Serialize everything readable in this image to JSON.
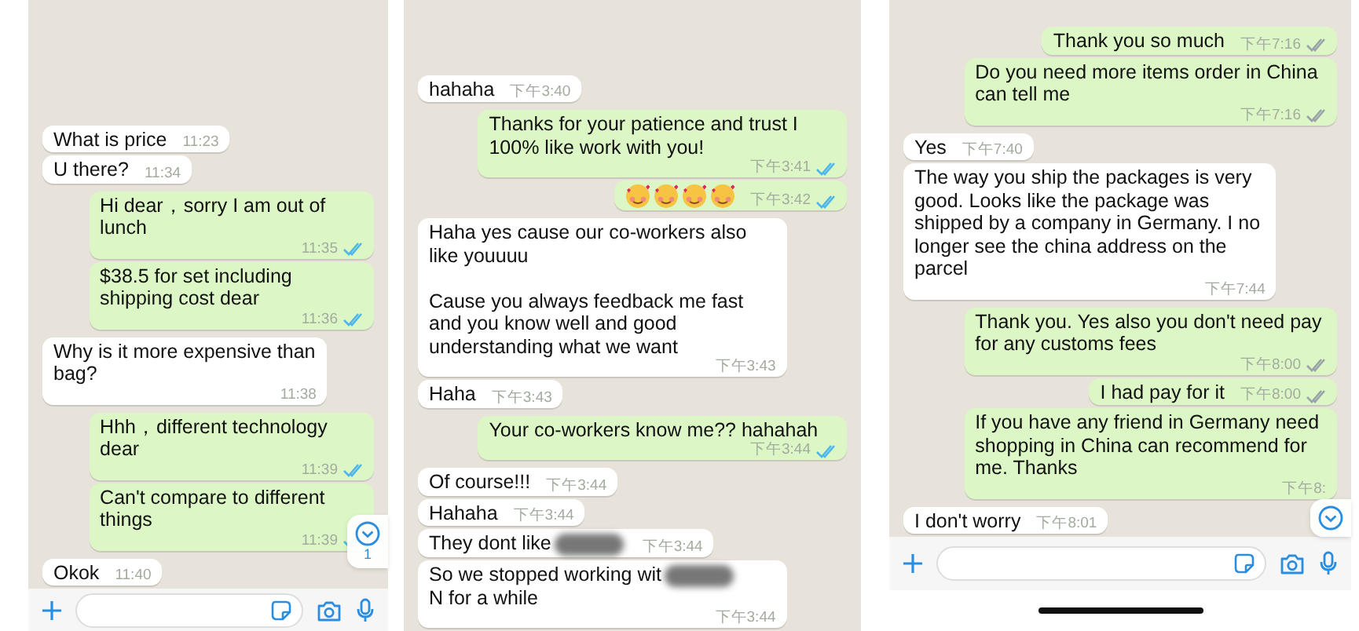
{
  "panels": [
    {
      "messages": [
        {
          "outgoing": false,
          "text": "What is price",
          "time": "11:23"
        },
        {
          "outgoing": false,
          "text": "U there?",
          "time": "11:34"
        },
        {
          "outgoing": true,
          "text": "Hi dear，sorry I am out of lunch",
          "time": "11:35",
          "read": true
        },
        {
          "outgoing": true,
          "text": "$38.5 for set including shipping cost dear",
          "time": "11:36",
          "read": true
        },
        {
          "outgoing": false,
          "text": "Why is it more expensive than bag?",
          "time": "11:38"
        },
        {
          "outgoing": true,
          "text": "Hhh，different technology dear",
          "time": "11:39",
          "read": true
        },
        {
          "outgoing": true,
          "text": "Can't compare to different things",
          "time": "11:39",
          "read": true
        },
        {
          "outgoing": false,
          "text": "Okok",
          "time": "11:40"
        }
      ],
      "scroll_down": true,
      "unread_badge": "1",
      "composer": true
    },
    {
      "messages": [
        {
          "outgoing": false,
          "text": "hahaha",
          "time": "下午3:40"
        },
        {
          "outgoing": true,
          "text": "Thanks for your patience and trust I 100% like work with you!",
          "time": "下午3:41",
          "read": true
        },
        {
          "outgoing": true,
          "kind": "emoji",
          "emojis": [
            {
              "kind": "heart-face"
            },
            {
              "kind": "heart-face"
            },
            {
              "kind": "heart-face"
            },
            {
              "kind": "heart-face"
            }
          ],
          "time": "下午3:42",
          "read": true
        },
        {
          "outgoing": false,
          "text": "Haha yes cause our co-workers also like youuuu\n\nCause you always feedback me fast and you know well and good understanding what we want",
          "time": "下午3:43"
        },
        {
          "outgoing": false,
          "text": "Haha",
          "time": "下午3:43"
        },
        {
          "outgoing": true,
          "text": "Your co-workers know me?? hahahah",
          "time": "下午3:44",
          "read": true
        },
        {
          "outgoing": false,
          "text": "Of course!!!",
          "time": "下午3:44"
        },
        {
          "outgoing": false,
          "text": "Hahaha",
          "time": "下午3:44"
        },
        {
          "outgoing": false,
          "text": "They dont like",
          "redacted": true,
          "time": "下午3:44"
        },
        {
          "outgoing": false,
          "text": "So we stopped working wit",
          "redacted": true,
          "text_after": "N for a while",
          "time": "下午3:44"
        }
      ]
    },
    {
      "messages": [
        {
          "outgoing": true,
          "text": "Thank you so much",
          "time": "下午7:16",
          "read": false
        },
        {
          "outgoing": true,
          "text": "Do you need more items order in China can tell me",
          "time": "下午7:16",
          "read": false
        },
        {
          "outgoing": false,
          "text": "Yes",
          "time": "下午7:40"
        },
        {
          "outgoing": false,
          "text": "The way you ship the packages is very good.  Looks like the package was shipped by a company in Germany.  I no longer see the china address on the parcel",
          "time": "下午7:44"
        },
        {
          "outgoing": true,
          "text": "Thank you. Yes also you don't need pay for any customs fees",
          "time": "下午8:00",
          "read": false
        },
        {
          "outgoing": true,
          "text": "I had pay for it",
          "time": "下午8:00",
          "read": false
        },
        {
          "outgoing": true,
          "text": "If you have any friend in Germany need shopping in China can recommend for me. Thanks",
          "time": "下午8:"
        },
        {
          "outgoing": false,
          "text": "I don't worry",
          "time": "下午8:01"
        }
      ],
      "scroll_down": true,
      "composer": true,
      "home_indicator": true
    }
  ]
}
